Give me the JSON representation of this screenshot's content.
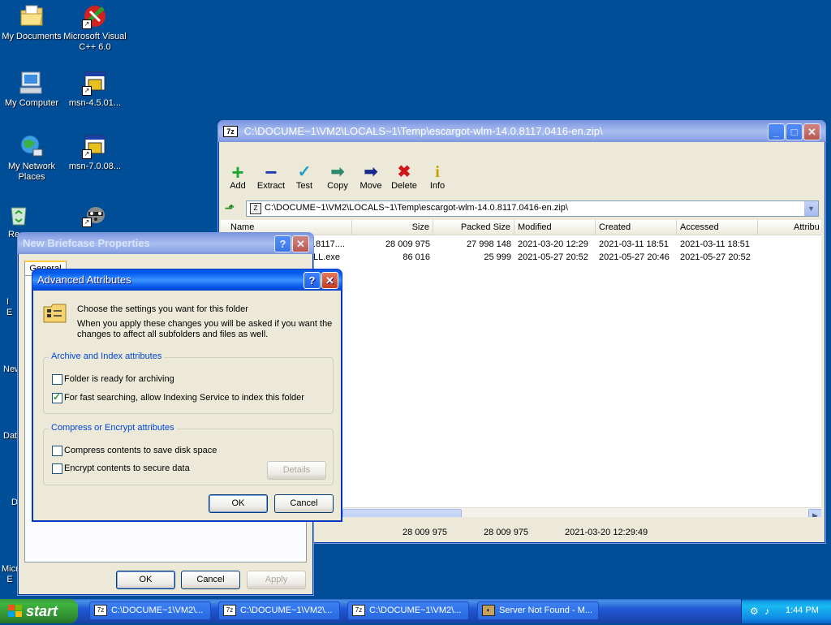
{
  "desktop": {
    "icons": [
      {
        "label": "My Documents"
      },
      {
        "label": "Microsoft Visual C++ 6.0"
      },
      {
        "label": "My Computer"
      },
      {
        "label": "msn-4.5.01..."
      },
      {
        "label": "My Network Places"
      },
      {
        "label": "msn-7.0.08..."
      },
      {
        "label": "Re"
      },
      {
        "label": "I\nE"
      },
      {
        "label": "New"
      },
      {
        "label": "Dat"
      },
      {
        "label": "D"
      },
      {
        "label": "Micr\nE"
      }
    ]
  },
  "sevenzip": {
    "title": "C:\\DOCUME~1\\VM2\\LOCALS~1\\Temp\\escargot-wlm-14.0.8117.0416-en.zip\\",
    "app_icon": "7z",
    "toolbar": [
      {
        "label": "Add",
        "icon": "plus-icon",
        "glyph": "+",
        "color": "#1fa82f"
      },
      {
        "label": "Extract",
        "icon": "minus-icon",
        "glyph": "−",
        "color": "#1d3bb0"
      },
      {
        "label": "Test",
        "icon": "check-icon",
        "glyph": "✓",
        "color": "#20a0c8"
      },
      {
        "label": "Copy",
        "icon": "copy-arrow-icon",
        "glyph": "➡",
        "color": "#2a8a6a"
      },
      {
        "label": "Move",
        "icon": "move-arrow-icon",
        "glyph": "➡",
        "color": "#1a2a8c"
      },
      {
        "label": "Delete",
        "icon": "delete-x-icon",
        "glyph": "✖",
        "color": "#d01818"
      },
      {
        "label": "Info",
        "icon": "info-icon",
        "glyph": "i",
        "color": "#c8a000"
      }
    ],
    "path": "C:\\DOCUME~1\\VM2\\LOCALS~1\\Temp\\escargot-wlm-14.0.8117.0416-en.zip\\",
    "columns": [
      "Name",
      "Size",
      "Packed Size",
      "Modified",
      "Created",
      "Accessed",
      "Attribu"
    ],
    "rows": [
      {
        "name": ".8117....",
        "size": "28 009 975",
        "packed": "27 998 148",
        "modified": "2021-03-20 12:29",
        "created": "2021-03-11 18:51",
        "accessed": "2021-03-11 18:51"
      },
      {
        "name": "LL.exe",
        "size": "86 016",
        "packed": "25 999",
        "modified": "2021-05-27 20:52",
        "created": "2021-05-27 20:46",
        "accessed": "2021-05-27 20:52"
      }
    ],
    "status": {
      "size": "28 009 975",
      "packed": "28 009 975",
      "modified": "2021-03-20 12:29:49"
    }
  },
  "briefcase": {
    "title": "New Briefcase Properties",
    "tab": "General",
    "ok": "OK",
    "cancel": "Cancel",
    "apply": "Apply"
  },
  "advanced": {
    "title": "Advanced Attributes",
    "intro_line1": "Choose the settings you want for this folder",
    "intro_line2": "When you apply these changes you will be asked if you want the",
    "intro_line3": "changes to affect all subfolders and files as well.",
    "group1_title": "Archive and Index attributes",
    "archive_label": "Folder is ready for archiving",
    "archive_checked": false,
    "index_label": "For fast searching, allow Indexing Service to index this folder",
    "index_checked": true,
    "group2_title": "Compress or Encrypt attributes",
    "compress_label": "Compress contents to save disk space",
    "compress_checked": false,
    "encrypt_label": "Encrypt contents to secure data",
    "encrypt_checked": false,
    "details": "Details",
    "ok": "OK",
    "cancel": "Cancel"
  },
  "taskbar": {
    "start": "start",
    "tasks": [
      {
        "label": "C:\\DOCUME~1\\VM2\\..."
      },
      {
        "label": "C:\\DOCUME~1\\VM2\\..."
      },
      {
        "label": "C:\\DOCUME~1\\VM2\\..."
      },
      {
        "label": "Server Not Found - M..."
      }
    ],
    "clock": "1:44 PM"
  },
  "colors": {
    "desktop": "#004e98",
    "accent": "#0054e3",
    "group_title": "#0046d5"
  }
}
